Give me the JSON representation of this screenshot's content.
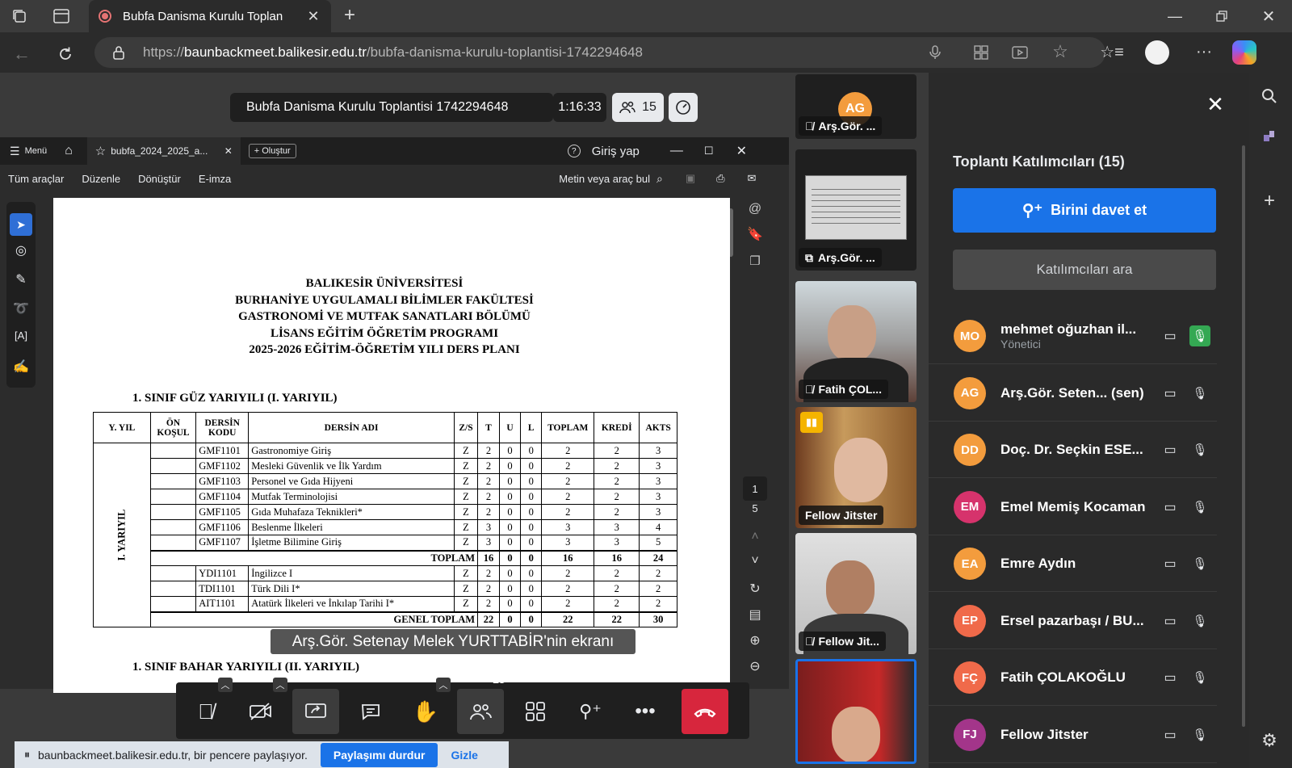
{
  "browser": {
    "tab_title": "Bubfa Danisma Kurulu Toplan",
    "url_prefix": "https://",
    "url_host": "baunbackmeet.balikesir.edu.tr",
    "url_path": "/bubfa-danisma-kurulu-toplantisi-1742294648"
  },
  "meeting": {
    "title": "Bubfa Danisma Kurulu Toplantisi 1742294648",
    "timer": "1:16:33",
    "participant_count": "15",
    "screen_share_label": "Arş.Gör. Setenay Melek YURTTABİR'nin ekranı",
    "sharing_notice": "baunbackmeet.balikesir.edu.tr, bir pencere paylaşıyor.",
    "stop_sharing": "Paylaşımı durdur",
    "hide": "Gizle"
  },
  "pdf": {
    "menu": "Menü",
    "tab": "bubfa_2024_2025_a...",
    "create": "Oluştur",
    "signin": "Giriş yap",
    "toolbar": [
      "Tüm araçlar",
      "Düzenle",
      "Dönüştür",
      "E-imza"
    ],
    "search": "Metin veya araç bul",
    "page_current": "1",
    "page_total": "5",
    "heading": [
      "BALIKESİR ÜNİVERSİTESİ",
      "BURHANİYE UYGULAMALI BİLİMLER FAKÜLTESİ",
      "GASTRONOMİ VE MUTFAK SANATLARI BÖLÜMÜ",
      "LİSANS EĞİTİM ÖĞRETİM PROGRAMI",
      "2025-2026 EĞİTİM-ÖĞRETİM YILI DERS PLANI"
    ],
    "section1": "1.   SINIF GÜZ YARIYILI (I. YARIYIL)",
    "section2": "1.   SINIF BAHAR YARIYILI (II. YARIYIL)",
    "semester_label": "I. YARIYIL",
    "columns": [
      "Y. YIL",
      "ÖN KOŞUL",
      "DERSİN KODU",
      "DERSİN ADI",
      "Z/S",
      "T",
      "U",
      "L",
      "TOPLAM",
      "KREDİ",
      "AKTS"
    ],
    "rows": [
      [
        "GMF1101",
        "Gastronomiye Giriş",
        "Z",
        "2",
        "0",
        "0",
        "2",
        "2",
        "3"
      ],
      [
        "GMF1102",
        "Mesleki Güvenlik ve İlk Yardım",
        "Z",
        "2",
        "0",
        "0",
        "2",
        "2",
        "3"
      ],
      [
        "GMF1103",
        "Personel ve Gıda Hijyeni",
        "Z",
        "2",
        "0",
        "0",
        "2",
        "2",
        "3"
      ],
      [
        "GMF1104",
        "Mutfak Terminolojisi",
        "Z",
        "2",
        "0",
        "0",
        "2",
        "2",
        "3"
      ],
      [
        "GMF1105",
        "Gıda Muhafaza Teknikleri*",
        "Z",
        "2",
        "0",
        "0",
        "2",
        "2",
        "3"
      ],
      [
        "GMF1106",
        "Beslenme İlkeleri",
        "Z",
        "3",
        "0",
        "0",
        "3",
        "3",
        "4"
      ],
      [
        "GMF1107",
        "İşletme Bilimine Giriş",
        "Z",
        "3",
        "0",
        "0",
        "3",
        "3",
        "5"
      ]
    ],
    "total": [
      "TOPLAM",
      "16",
      "0",
      "0",
      "16",
      "16",
      "24"
    ],
    "rows2": [
      [
        "YDI1101",
        "İngilizce I",
        "Z",
        "2",
        "0",
        "0",
        "2",
        "2",
        "2"
      ],
      [
        "TDI1101",
        "Türk Dili I*",
        "Z",
        "2",
        "0",
        "0",
        "2",
        "2",
        "2"
      ],
      [
        "AIT1101",
        "Atatürk İlkeleri ve İnkılap Tarihi I*",
        "Z",
        "2",
        "0",
        "0",
        "2",
        "2",
        "2"
      ]
    ],
    "grand_total": [
      "GENEL TOPLAM",
      "22",
      "0",
      "0",
      "22",
      "22",
      "30"
    ]
  },
  "tiles": [
    {
      "initials": "AG",
      "name": "Arş.Gör. ..."
    },
    {
      "name": "Arş.Gör. ..."
    },
    {
      "name": "Fatih ÇOL..."
    },
    {
      "name": "Fellow Jitster"
    },
    {
      "name": "Fellow Jit..."
    }
  ],
  "panel": {
    "title": "Toplantı Katılımcıları (15)",
    "invite": "Birini davet et",
    "search": "Katılımcıları ara",
    "participants": [
      {
        "initials": "MO",
        "name": "mehmet oğuzhan il...",
        "role": "Yönetici",
        "color": "#f39c3d"
      },
      {
        "initials": "AG",
        "name": "Arş.Gör. Seten... (sen)",
        "color": "#f39c3d"
      },
      {
        "initials": "DD",
        "name": "Doç. Dr. Seçkin ESE...",
        "color": "#f39c3d"
      },
      {
        "initials": "EM",
        "name": "Emel Memiş Kocaman",
        "color": "#d6336c"
      },
      {
        "initials": "EA",
        "name": "Emre Aydın",
        "color": "#f39c3d"
      },
      {
        "initials": "EP",
        "name": "Ersel pazarbaşı / BU...",
        "color": "#f06a4a"
      },
      {
        "initials": "FÇ",
        "name": "Fatih ÇOLAKOĞLU",
        "color": "#f06a4a"
      },
      {
        "initials": "FJ",
        "name": "Fellow Jitster",
        "color": "#a3358a"
      }
    ]
  },
  "controls": {
    "participants_badge": "15"
  },
  "colors": {
    "accent": "#1a73e8",
    "leave": "#d7263d",
    "mic_active": "#34a853"
  }
}
